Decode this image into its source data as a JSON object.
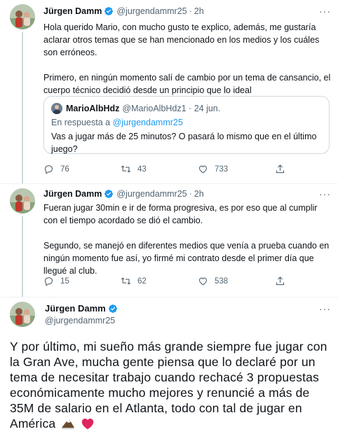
{
  "tweet1": {
    "name": "Jürgen Damm",
    "handle": "@jurgendammr25",
    "dot": "·",
    "time": "2h",
    "more": "···",
    "paragraphs": [
      "Hola querido Mario, con mucho gusto te explico, además, me gustaría aclarar otros temas que se han mencionado en los medios y los cuáles son erróneos.",
      "Primero, en ningún momento salí de cambio por un tema de cansancio, el cuerpo técnico decidió desde un principio que lo ideal"
    ],
    "quote": {
      "name": "MarioAlbHdz",
      "handle": "@MarioAlbHdz1 · 24 jun.",
      "reply_prefix": "En respuesta a ",
      "reply_handle": "@jurgendammr25",
      "text": "Vas a jugar más de 25 minutos? O pasará lo mismo que en el último juego?"
    },
    "replies": "76",
    "retweets": "43",
    "likes": "733"
  },
  "tweet2": {
    "name": "Jürgen Damm",
    "handle": "@jurgendammr25",
    "dot": "·",
    "time": "2h",
    "more": "···",
    "paragraphs": [
      "Fueran jugar 30min e ir de forma progresiva, es por eso que al cumplir con el tiempo acordado se dió el cambio.",
      "Segundo, se manejó en diferentes medios que venía a prueba cuando en ningún momento fue así, yo firmé mi contrato desde el primer día que llegué al club."
    ],
    "replies": "15",
    "retweets": "62",
    "likes": "538"
  },
  "tweet3": {
    "name": "Jürgen Damm",
    "handle": "@jurgendammr25",
    "more": "···",
    "text": "Y por último, mi sueño más grande siempre fue jugar con la Gran Ave, mucha gente piensa que lo declaré por un tema de necesitar trabajo cuando rechacé 3 propuestas económicamente mucho mejores y renuncié a más de 35M de salario en el Atlanta, todo con tal de jugar en América"
  },
  "colors": {
    "verified": "#1d9bf0",
    "text": "#0f1419",
    "secondary": "#536471",
    "link": "#1d9bf0",
    "heart": "#f91880"
  },
  "icons": [
    "verified-badge-icon",
    "reply-icon",
    "retweet-icon",
    "like-icon",
    "share-icon",
    "more-icon",
    "eagle-emoji",
    "red-heart-emoji"
  ]
}
